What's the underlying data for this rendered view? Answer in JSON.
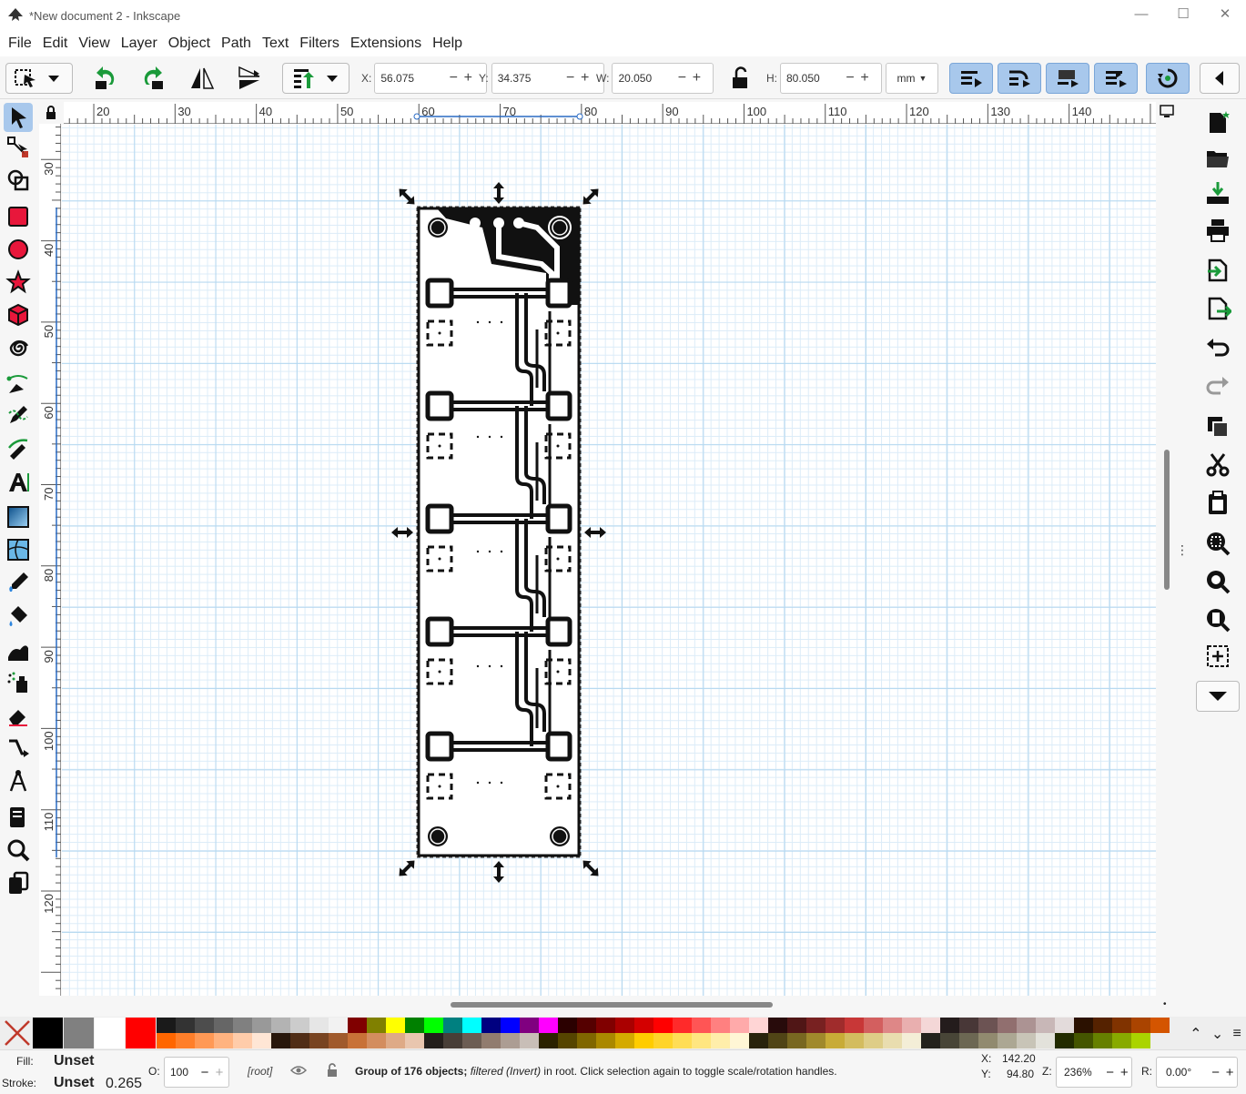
{
  "window": {
    "title": "*New document 2 - Inkscape",
    "controls": {
      "minimize": "—",
      "maximize": "☐",
      "close": "✕"
    }
  },
  "menu": [
    "File",
    "Edit",
    "View",
    "Layer",
    "Object",
    "Path",
    "Text",
    "Filters",
    "Extensions",
    "Help"
  ],
  "toolbar": {
    "x": {
      "label": "X:",
      "value": "56.075"
    },
    "y": {
      "label": "Y:",
      "value": "34.375"
    },
    "w": {
      "label": "W:",
      "value": "20.050"
    },
    "h": {
      "label": "H:",
      "value": "80.050"
    },
    "units": "mm"
  },
  "rulers": {
    "horizontal": [
      "20",
      "30",
      "40",
      "50",
      "60",
      "70",
      "80",
      "90",
      "100",
      "110",
      "120",
      "130",
      "140"
    ],
    "vertical": [
      "30",
      "40",
      "50",
      "60",
      "70",
      "80",
      "90",
      "100",
      "110",
      "120"
    ]
  },
  "left_tools": [
    "selector-icon",
    "node-icon",
    "shape-builder-icon",
    "rectangle-icon",
    "circle-icon",
    "star-icon",
    "box3d-icon",
    "spiral-icon",
    "pen-icon",
    "pencil-icon",
    "calligraphy-icon",
    "text-icon",
    "gradient-icon",
    "mesh-icon",
    "dropper-icon",
    "paint-bucket-icon",
    "tweak-icon",
    "spray-icon",
    "eraser-icon",
    "connector-icon",
    "measure-icon",
    "pages-icon",
    "zoom-icon",
    "clone-icon"
  ],
  "right_tools": [
    "new-document-icon",
    "open-icon",
    "import-icon",
    "print-icon",
    "export-icon",
    "export-doc-icon",
    "undo-icon",
    "redo-icon",
    "duplicate-icon",
    "cut-icon",
    "paste-icon",
    "zoom-selection-icon",
    "zoom-drawing-icon",
    "zoom-page-icon",
    "zoom-center-icon",
    "more-icon"
  ],
  "colors": {
    "accent": "#a8c8ec",
    "pcb": "#111111"
  },
  "palette_top": [
    "#000000",
    "#808080",
    "#ffffff",
    "#ff0000",
    "#1a1a1a",
    "#333333",
    "#4d4d4d",
    "#666666",
    "#808080",
    "#999999",
    "#b3b3b3",
    "#cccccc",
    "#e6e6e6",
    "#f2f2f2",
    "#800000",
    "#808000",
    "#ffff00",
    "#008000",
    "#00ff00",
    "#008080",
    "#00ffff",
    "#000080",
    "#0000ff",
    "#800080",
    "#ff00ff",
    "#2b0000",
    "#550000",
    "#800000",
    "#aa0000",
    "#d40000",
    "#ff0000",
    "#ff2a2a",
    "#ff5555",
    "#ff8080",
    "#ffaaaa",
    "#ffd5d5",
    "#280b0b",
    "#501616",
    "#782121",
    "#a02c2c",
    "#c83737",
    "#d35f5f",
    "#de8787",
    "#e9afaf",
    "#f4d7d7",
    "#241c1c",
    "#483737",
    "#6c5353",
    "#916f6f",
    "#ac9393",
    "#c8b7b7",
    "#e3dbdb",
    "#2b1100",
    "#552200",
    "#803300",
    "#aa4400",
    "#d45500"
  ],
  "palette_bottom": [
    "#ff6600",
    "#ff7f2a",
    "#ff9955",
    "#ffb380",
    "#ffccaa",
    "#ffe6d5",
    "#28170b",
    "#502d16",
    "#784421",
    "#a05a2c",
    "#c87137",
    "#d38d5f",
    "#deaa87",
    "#e9c6af",
    "#241f1c",
    "#483e37",
    "#6c5d53",
    "#917c6f",
    "#ac9d93",
    "#c8beb7",
    "#2b2200",
    "#554400",
    "#806600",
    "#aa8800",
    "#d4aa00",
    "#ffcc00",
    "#ffd42a",
    "#ffdd55",
    "#ffe680",
    "#ffeeaa",
    "#fff6d5",
    "#28220b",
    "#504416",
    "#786721",
    "#a0892c",
    "#c8ab37",
    "#d3bc5f",
    "#decd87",
    "#e9ddaf",
    "#f4eed7",
    "#24221c",
    "#484537",
    "#6c6753",
    "#918a6f",
    "#aca793",
    "#c8c4b7",
    "#e3e2db",
    "#222b00",
    "#445500",
    "#668000",
    "#88aa00",
    "#aad400"
  ],
  "status": {
    "fill_label": "Fill:",
    "fill_value": "Unset",
    "stroke_label": "Stroke:",
    "stroke_value": "Unset",
    "stroke_width": "0.265",
    "opacity_label": "O:",
    "opacity_value": "100",
    "layer": "[root]",
    "message_bold": "Group of 176 objects;",
    "message_italic": "filtered (Invert)",
    "message_rest": "in root. Click selection again to toggle scale/rotation handles.",
    "cursor_x_label": "X:",
    "cursor_x": "142.20",
    "cursor_y_label": "Y:",
    "cursor_y": "94.80",
    "zoom_label": "Z:",
    "zoom_value": "236%",
    "rotation_label": "R:",
    "rotation_value": "0.00°"
  }
}
